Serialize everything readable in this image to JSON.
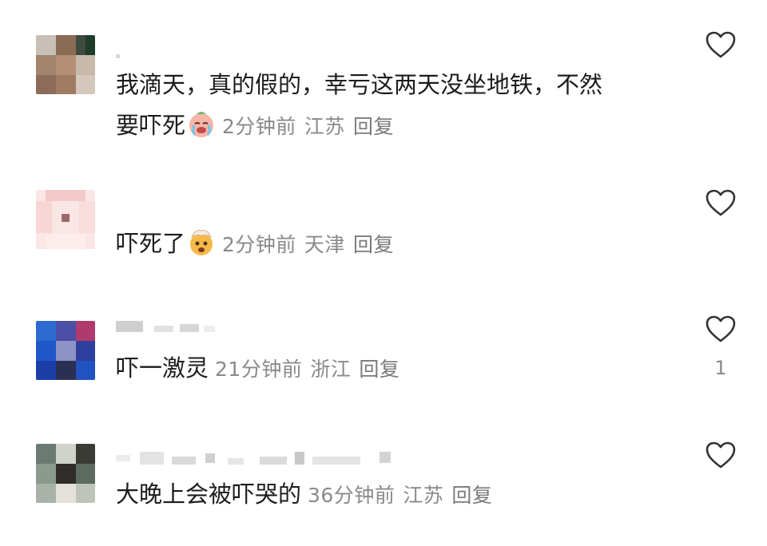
{
  "comments": [
    {
      "text_line1": "我滴天，真的假的，幸亏这两天没坐地铁，不然",
      "text_line2": "要吓死",
      "emoji": "crying-face",
      "time": "2分钟前",
      "location": "江苏",
      "reply": "回复",
      "likes": null
    },
    {
      "text": "吓死了",
      "emoji": "exploding-head",
      "time": "2分钟前",
      "location": "天津",
      "reply": "回复",
      "likes": null
    },
    {
      "text": "吓一激灵",
      "time": "21分钟前",
      "location": "浙江",
      "reply": "回复",
      "likes": "1"
    },
    {
      "text": "大晚上会被吓哭的",
      "time": "36分钟前",
      "location": "江苏",
      "reply": "回复",
      "likes": null
    }
  ],
  "icons": {
    "like": "heart-outline-icon"
  },
  "colors": {
    "text": "#1c1c1c",
    "meta": "#8a8a8a",
    "heart": "#333333"
  }
}
